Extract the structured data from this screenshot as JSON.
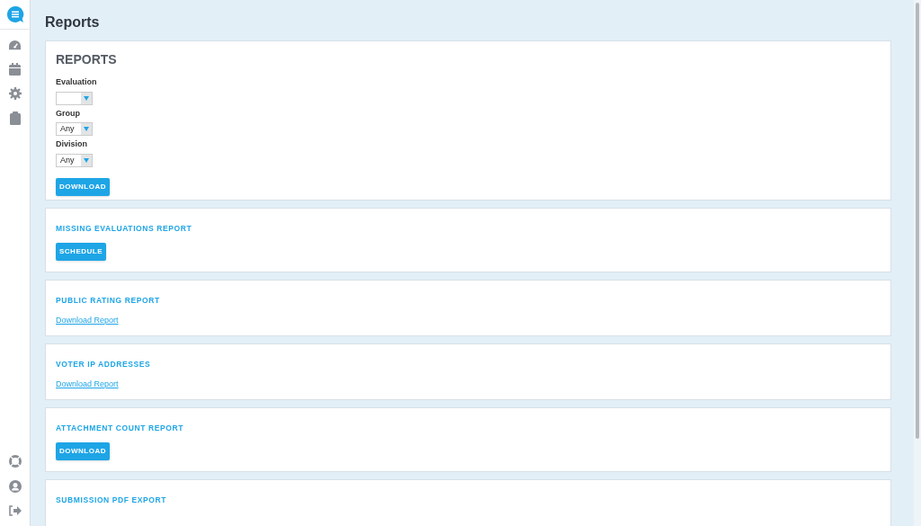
{
  "page_title": "Reports",
  "reports_card": {
    "title": "REPORTS",
    "fields": [
      {
        "label": "Evaluation"
      },
      {
        "label": "Group",
        "value": "Any"
      },
      {
        "label": "Division",
        "value": "Any"
      }
    ],
    "button": "DOWNLOAD"
  },
  "sections": [
    {
      "title": "MISSING EVALUATIONS REPORT",
      "kind": "button",
      "action": "SCHEDULE"
    },
    {
      "title": "PUBLIC RATING REPORT",
      "kind": "link",
      "action": "Download Report"
    },
    {
      "title": "VOTER IP ADDRESSES",
      "kind": "link",
      "action": "Download Report"
    },
    {
      "title": "ATTACHMENT COUNT REPORT",
      "kind": "button",
      "action": "DOWNLOAD"
    },
    {
      "title": "SUBMISSION PDF EXPORT",
      "kind": "none"
    }
  ]
}
